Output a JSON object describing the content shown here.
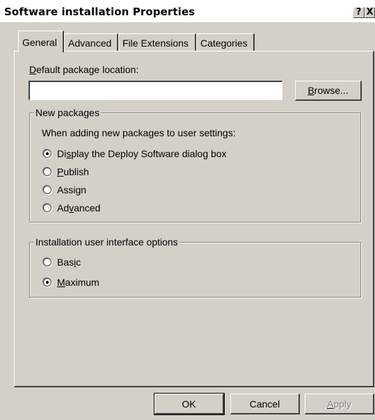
{
  "window": {
    "title": "Software installation Properties",
    "help_button": "?",
    "close_button": "X"
  },
  "tabs": [
    {
      "label": "General",
      "active": true
    },
    {
      "label": "Advanced",
      "active": false
    },
    {
      "label": "File Extensions",
      "active": false
    },
    {
      "label": "Categories",
      "active": false
    }
  ],
  "general": {
    "location_label_pre": "",
    "location_label_key": "D",
    "location_label_post": "efault package location:",
    "location_value": "",
    "browse_pre": "",
    "browse_key": "B",
    "browse_post": "rowse..."
  },
  "new_packages": {
    "legend": "New packages",
    "description": "When adding new packages to user settings:",
    "options": [
      {
        "pre": "Di",
        "key": "s",
        "post": "play the Deploy Software dialog box",
        "checked": true
      },
      {
        "pre": "",
        "key": "P",
        "post": "ublish",
        "checked": false
      },
      {
        "pre": "Assi",
        "key": "g",
        "post": "n",
        "checked": false
      },
      {
        "pre": "Ad",
        "key": "v",
        "post": "anced",
        "checked": false
      }
    ]
  },
  "ui_options": {
    "legend": "Installation user interface options",
    "options": [
      {
        "pre": "Bas",
        "key": "i",
        "post": "c",
        "checked": false
      },
      {
        "pre": "",
        "key": "M",
        "post": "aximum",
        "checked": true
      }
    ]
  },
  "footer": {
    "ok": "OK",
    "cancel": "Cancel",
    "apply_pre": "",
    "apply_key": "A",
    "apply_post": "pply"
  }
}
